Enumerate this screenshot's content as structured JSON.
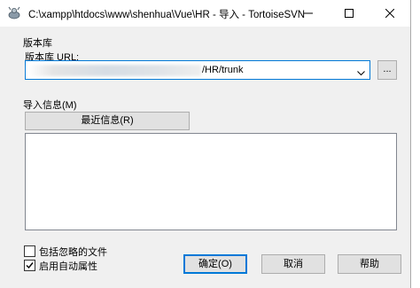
{
  "window": {
    "title": "C:\\xampp\\htdocs\\www\\shenhua\\Vue\\HR - 导入 - TortoiseSVN"
  },
  "repository": {
    "group_label": "版本库",
    "url_label": "版本库 URL:",
    "url_value_visible": "/HR/trunk",
    "browse_label": "..."
  },
  "import_message": {
    "group_label": "导入信息(M)",
    "recent_button_label": "最近信息(R)",
    "message_text": ""
  },
  "options": {
    "include_ignored_label": "包括忽略的文件",
    "include_ignored_checked": false,
    "auto_props_label": "启用自动属性",
    "auto_props_checked": true
  },
  "buttons": {
    "ok_label": "确定(O)",
    "cancel_label": "取消",
    "help_label": "帮助"
  },
  "icons": {
    "app": "tortoisesvn-icon",
    "minimize": "minimize-icon",
    "maximize": "maximize-icon",
    "close": "close-icon",
    "dropdown": "chevron-down-icon",
    "check": "checkmark-icon"
  }
}
